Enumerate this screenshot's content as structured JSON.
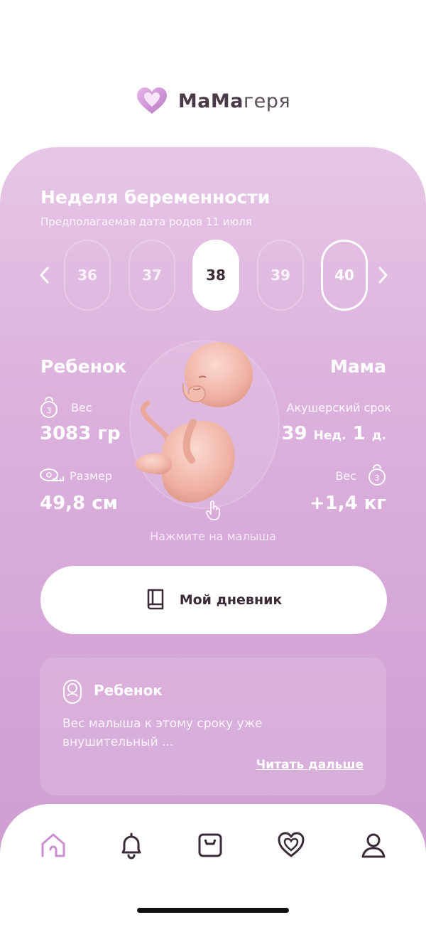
{
  "brand": {
    "name_bold": "МаМа",
    "name_light": "геря"
  },
  "week": {
    "title": "Неделя беременности",
    "due_date_label": "Предполагаемая дата родов 11 июля",
    "weeks": [
      "36",
      "37",
      "38",
      "39",
      "40"
    ],
    "selected": "38"
  },
  "baby": {
    "heading": "Ребенок",
    "weight_label": "Вес",
    "weight_value": "3083 гр",
    "size_label": "Размер",
    "size_value": "49,8 см"
  },
  "mom": {
    "heading": "Мама",
    "term_label": "Акушерский срок",
    "term_weeks": "39",
    "term_weeks_unit": "Нед.",
    "term_days": "1",
    "term_days_unit": "д.",
    "weight_label": "Вес",
    "weight_value": "+1,4 кг"
  },
  "tap_hint": "Нажмите на малыша",
  "diary_button": "Мой дневник",
  "article": {
    "title": "Ребенок",
    "body": "Вес малыша к этому сроку уже внушительный ...",
    "link": "Читать дальше"
  },
  "nav": [
    "home-icon",
    "bell-icon",
    "scale-icon",
    "heart-icon",
    "profile-icon"
  ],
  "colors": {
    "accent": "#c98fd0",
    "dark": "#3b2b39",
    "card_top": "#e6c6e6",
    "card_bottom": "#cf9dd2"
  }
}
